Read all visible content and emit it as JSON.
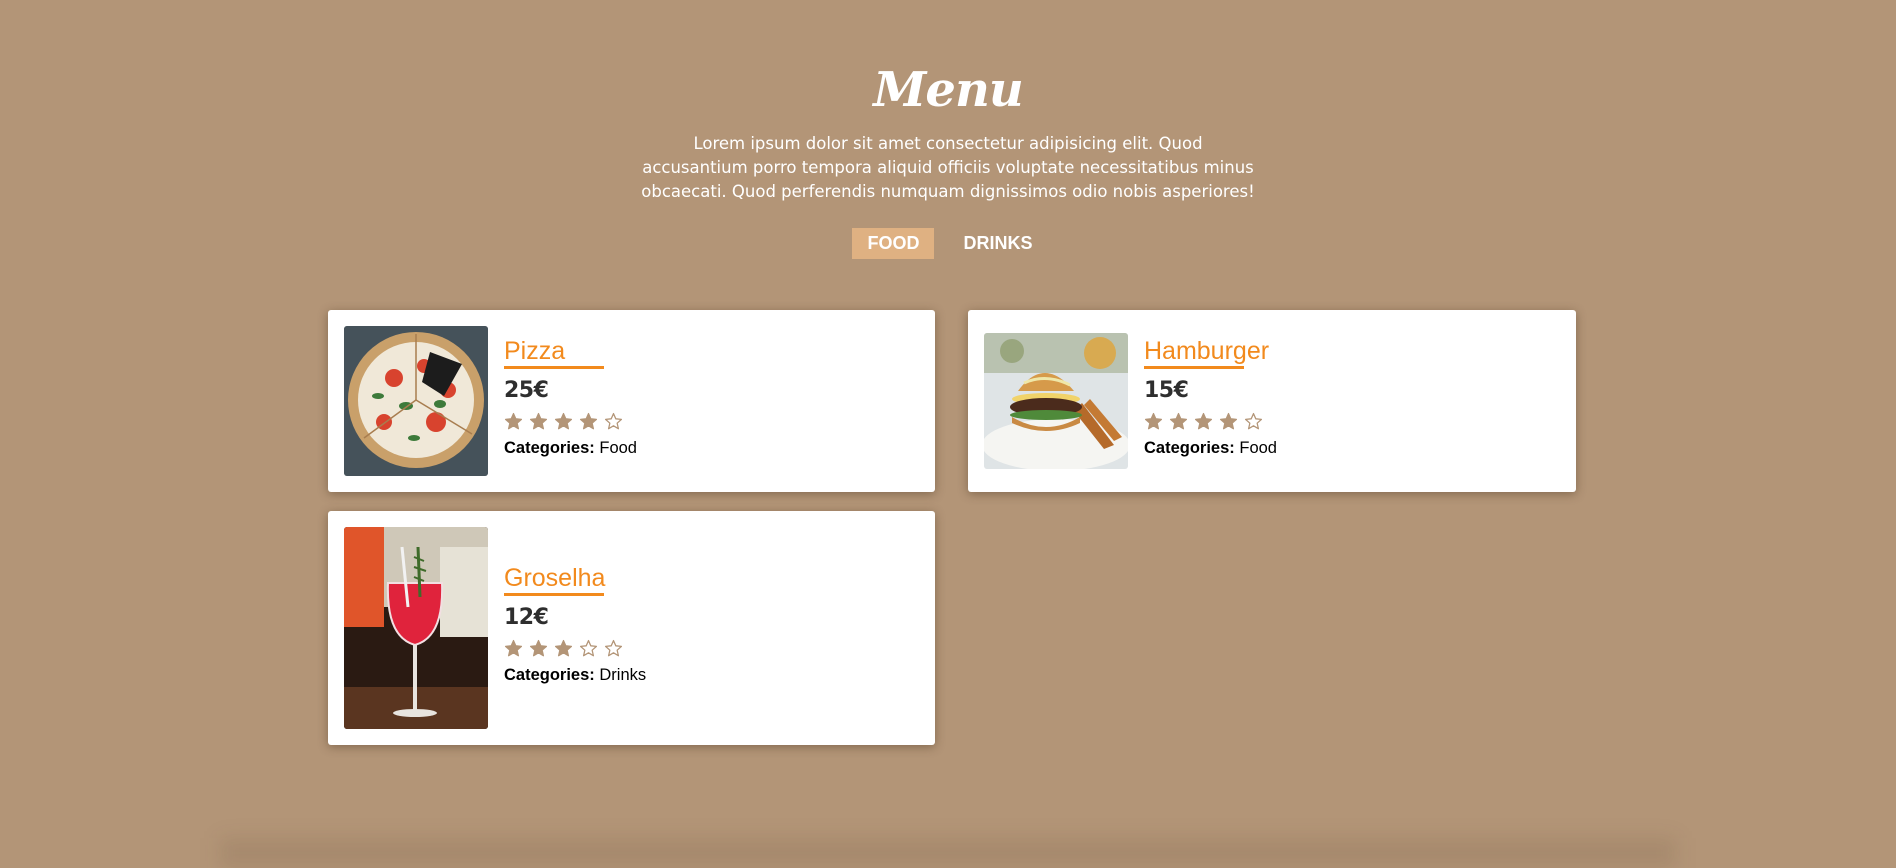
{
  "page": {
    "title": "Menu",
    "intro": "Lorem ipsum dolor sit amet consectetur adipisicing elit. Quod accusantium porro tempora aliquid officiis voluptate necessitatibus minus obcaecati. Quod perferendis numquam dignissimos odio nobis asperiores!"
  },
  "tabs": [
    {
      "label": "FOOD",
      "active": true
    },
    {
      "label": "DRINKS",
      "active": false
    }
  ],
  "items": [
    {
      "name": "Pizza",
      "price": "25€",
      "rating": 4,
      "max_rating": 5,
      "category_label": "Categories:",
      "category": "Food",
      "image_icon": "pizza-photo"
    },
    {
      "name": "Hamburger",
      "price": "15€",
      "rating": 4,
      "max_rating": 5,
      "category_label": "Categories:",
      "category": "Food",
      "image_icon": "hamburger-photo"
    },
    {
      "name": "Groselha",
      "price": "12€",
      "rating": 3,
      "max_rating": 5,
      "category_label": "Categories:",
      "category": "Drinks",
      "image_icon": "cocktail-photo"
    }
  ],
  "colors": {
    "background": "#b39577",
    "accent": "#f28a1d",
    "active_tab": "#dfb182",
    "star": "#b39577"
  }
}
